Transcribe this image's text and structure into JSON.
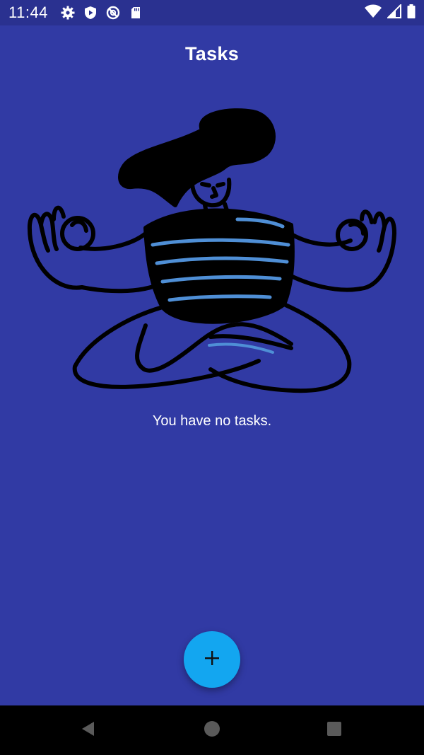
{
  "status_bar": {
    "time": "11:44",
    "left_icons": [
      "gear-icon",
      "play-protect-icon",
      "no-disturb-icon",
      "sd-card-icon"
    ],
    "right_icons": [
      "wifi-icon",
      "signal-icon",
      "battery-icon"
    ]
  },
  "app_bar": {
    "title": "Tasks"
  },
  "empty_state": {
    "illustration": "meditating-person-illustration",
    "message": "You have no tasks."
  },
  "fab": {
    "icon": "plus-icon",
    "color": "#13a6f0"
  },
  "nav_bar": {
    "buttons": [
      "back-icon",
      "home-icon",
      "recents-icon"
    ]
  },
  "colors": {
    "background": "#313aa4",
    "status_bar": "#2a3190",
    "accent": "#13a6f0"
  }
}
